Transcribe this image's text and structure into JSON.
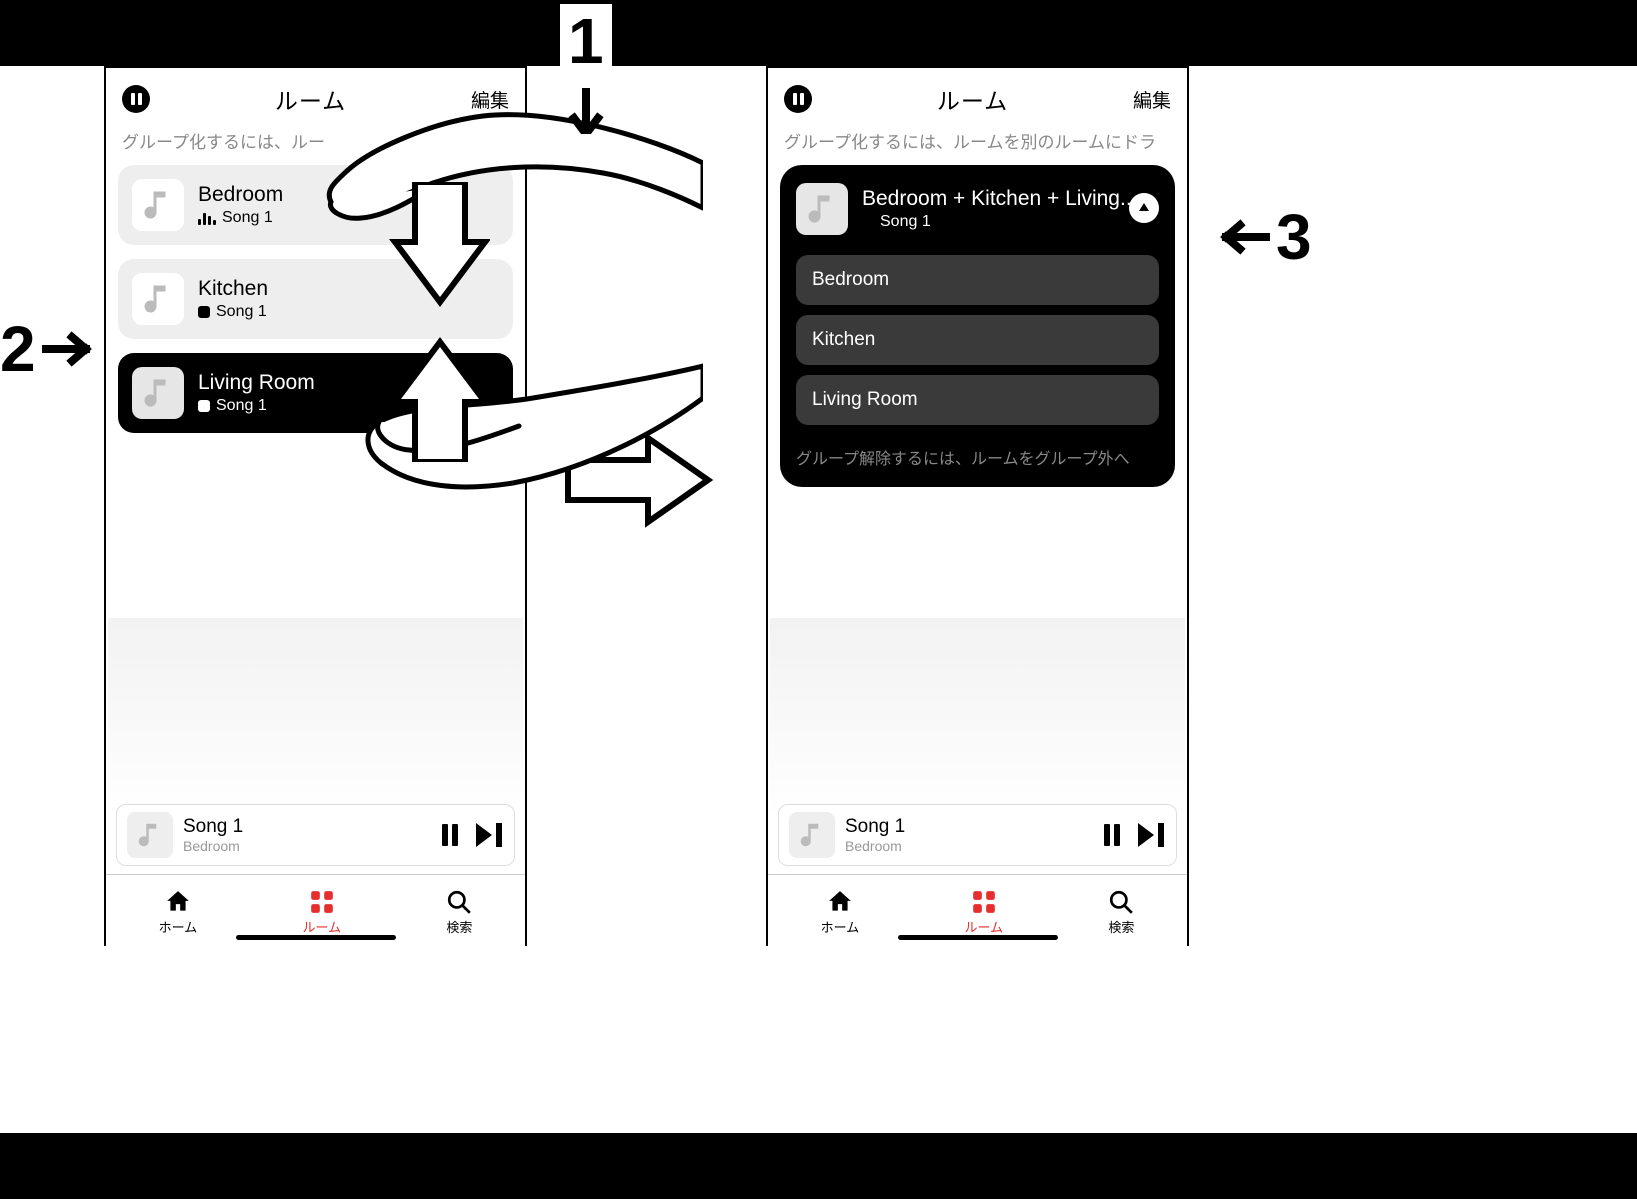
{
  "callouts": {
    "c1": "1",
    "c2": "2",
    "c3": "3"
  },
  "screenLeft": {
    "header": {
      "title": "ルーム",
      "edit": "編集"
    },
    "hint": "グループ化するには、ルー",
    "rooms": [
      {
        "name": "Bedroom",
        "song": "Song 1",
        "status": "playing",
        "variant": "light"
      },
      {
        "name": "Kitchen",
        "song": "Song 1",
        "status": "stopped",
        "variant": "light"
      },
      {
        "name": "Living Room",
        "song": "Song 1",
        "status": "stopped",
        "variant": "dark"
      }
    ]
  },
  "screenRight": {
    "header": {
      "title": "ルーム",
      "edit": "編集"
    },
    "hint": "グループ化するには、ルームを別のルームにドラ",
    "group": {
      "title": "Bedroom + Kitchen + Living..",
      "song": "Song 1",
      "items": [
        "Bedroom",
        "Kitchen",
        "Living Room"
      ],
      "footer_hint": "グループ解除するには、ルームをグループ外へ"
    }
  },
  "nowPlaying": {
    "title": "Song 1",
    "subtitle": "Bedroom"
  },
  "tabs": {
    "home": "ホーム",
    "rooms": "ルーム",
    "search": "検索"
  }
}
